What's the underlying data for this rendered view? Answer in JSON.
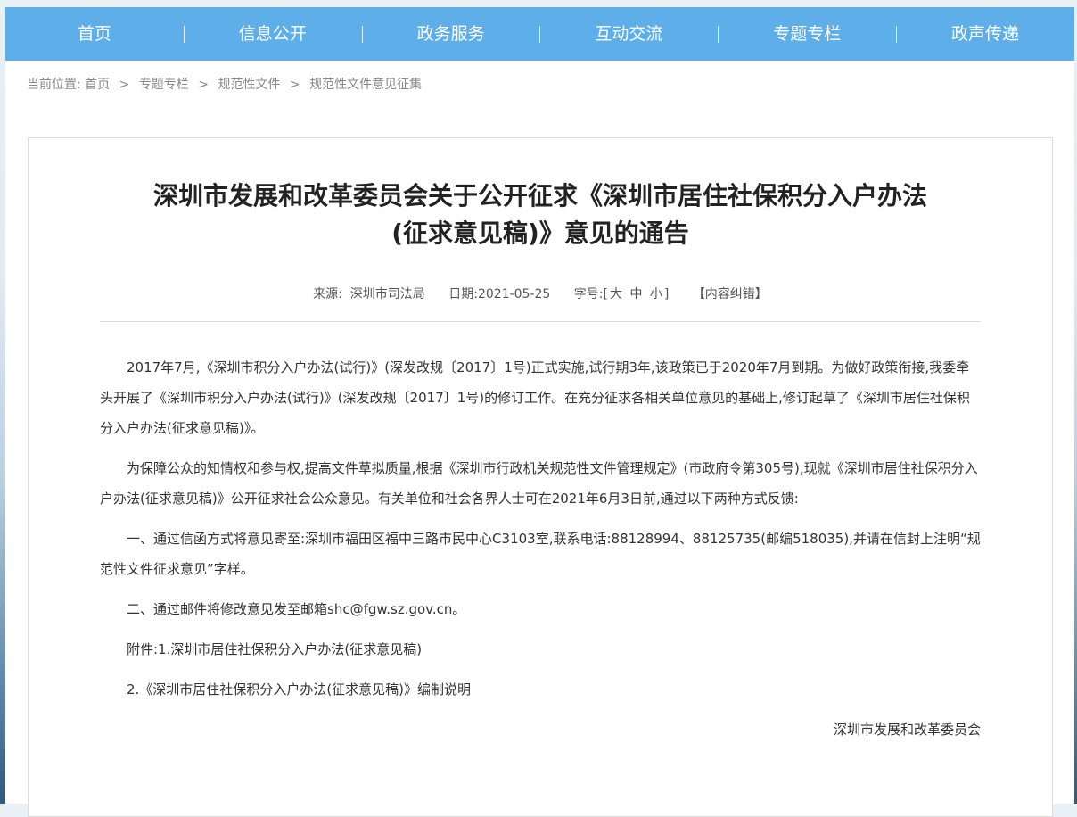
{
  "nav": {
    "items": [
      "首页",
      "信息公开",
      "政务服务",
      "互动交流",
      "专题专栏",
      "政声传递"
    ]
  },
  "breadcrumb": {
    "prefix": "当前位置:",
    "items": [
      "首页",
      "专题专栏",
      "规范性文件",
      "规范性文件意见征集"
    ],
    "separator": ">"
  },
  "article": {
    "title_line1": "深圳市发展和改革委员会关于公开征求《深圳市居住社保积分入户办法",
    "title_line2": "(征求意见稿)》意见的通告",
    "meta": {
      "source_label": "来源:",
      "source": "深圳市司法局",
      "date_label": "日期:",
      "date": "2021-05-25",
      "fontsize_label": "字号:",
      "bracket_open": "[",
      "font_large": "大",
      "font_medium": "中",
      "font_small": "小",
      "bracket_close": "]",
      "report": "【内容纠错】"
    },
    "paragraphs": [
      "2017年7月,《深圳市积分入户办法(试行)》(深发改规〔2017〕1号)正式实施,试行期3年,该政策已于2020年7月到期。为做好政策衔接,我委牵头开展了《深圳市积分入户办法(试行)》(深发改规〔2017〕1号)的修订工作。在充分征求各相关单位意见的基础上,修订起草了《深圳市居住社保积分入户办法(征求意见稿)》。",
      "为保障公众的知情权和参与权,提高文件草拟质量,根据《深圳市行政机关规范性文件管理规定》(市政府令第305号),现就《深圳市居住社保积分入户办法(征求意见稿)》公开征求社会公众意见。有关单位和社会各界人士可在2021年6月3日前,通过以下两种方式反馈:",
      "一、通过信函方式将意见寄至:深圳市福田区福中三路市民中心C3103室,联系电话:88128994、88125735(邮编518035),并请在信封上注明“规范性文件征求意见”字样。",
      "二、通过邮件将修改意见发至邮箱shc@fgw.sz.gov.cn。"
    ],
    "attachment_1": "附件:1.深圳市居住社保积分入户办法(征求意见稿)",
    "attachment_2": "2.《深圳市居住社保积分入户办法(征求意见稿)》编制说明",
    "signature": "深圳市发展和改革委员会"
  },
  "colors": {
    "nav_bg": "#5eaee9",
    "title": "#222222",
    "body_text": "#333333"
  }
}
